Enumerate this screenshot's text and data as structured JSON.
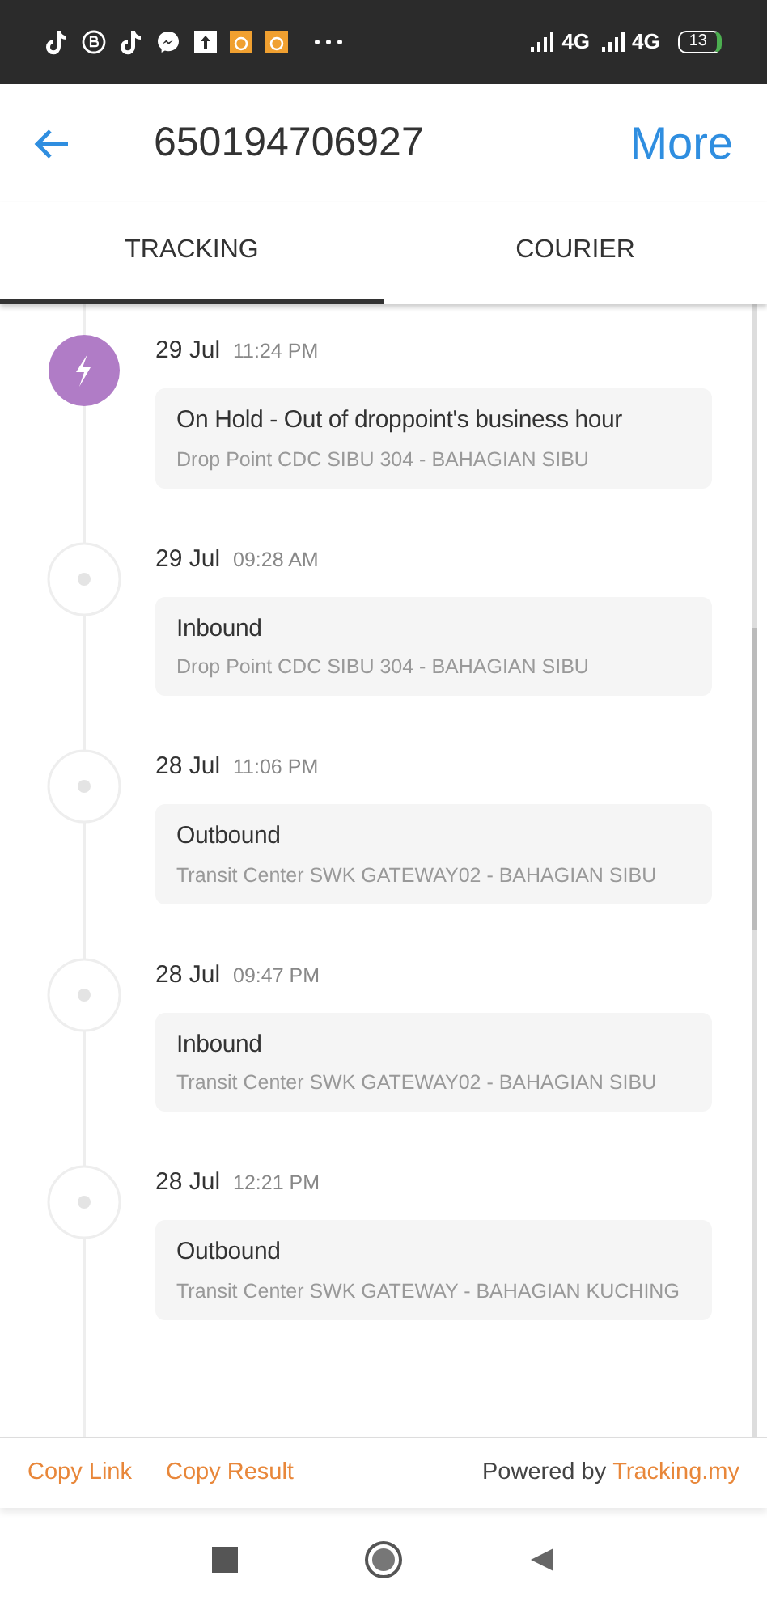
{
  "status_bar": {
    "network_1": "4G",
    "network_2": "4G",
    "battery": "13"
  },
  "header": {
    "title": "650194706927",
    "action": "More"
  },
  "tabs": [
    {
      "label": "TRACKING",
      "selected": true
    },
    {
      "label": "COURIER",
      "selected": false
    }
  ],
  "events": [
    {
      "kind": "hold",
      "date": "29 Jul",
      "time": "11:24 PM",
      "title": "On Hold - Out of droppoint's business hour",
      "location": "Drop Point CDC SIBU 304 - BAHAGIAN SIBU"
    },
    {
      "kind": "normal",
      "date": "29 Jul",
      "time": "09:28 AM",
      "title": "Inbound",
      "location": "Drop Point CDC SIBU 304 - BAHAGIAN SIBU"
    },
    {
      "kind": "normal",
      "date": "28 Jul",
      "time": "11:06 PM",
      "title": "Outbound",
      "location": "Transit Center SWK GATEWAY02 - BAHAGIAN SIBU"
    },
    {
      "kind": "normal",
      "date": "28 Jul",
      "time": "09:47 PM",
      "title": "Inbound",
      "location": "Transit Center SWK GATEWAY02 - BAHAGIAN SIBU"
    },
    {
      "kind": "normal",
      "date": "28 Jul",
      "time": "12:21 PM",
      "title": "Outbound",
      "location": "Transit Center SWK GATEWAY - BAHAGIAN KUCHING"
    }
  ],
  "footer": {
    "links": [
      "Copy Link",
      "Copy Result"
    ],
    "powered_by": "Powered by",
    "brand": "Tracking.my"
  }
}
